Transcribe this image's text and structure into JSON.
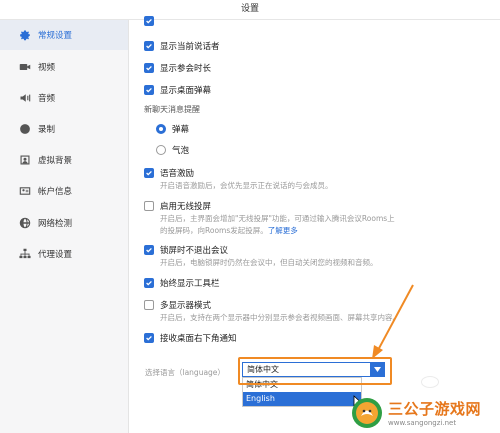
{
  "window": {
    "title": "设置"
  },
  "sidebar": {
    "items": [
      {
        "label": "常规设置",
        "icon": "gear-icon",
        "active": true
      },
      {
        "label": "视频",
        "icon": "video-camera-icon"
      },
      {
        "label": "音频",
        "icon": "speaker-icon"
      },
      {
        "label": "录制",
        "icon": "record-icon"
      },
      {
        "label": "虚拟背景",
        "icon": "person-frame-icon"
      },
      {
        "label": "帐户信息",
        "icon": "account-card-icon"
      },
      {
        "label": "网络检测",
        "icon": "globe-icon"
      },
      {
        "label": "代理设置",
        "icon": "network-icon"
      }
    ]
  },
  "settings": {
    "show_speaker": {
      "label": "显示当前说话者",
      "checked": true
    },
    "show_duration": {
      "label": "显示参会时长",
      "checked": true
    },
    "show_desktop_barrage": {
      "label": "显示桌面弹幕",
      "checked": true
    },
    "new_chat_label": "新聊天消息提醒",
    "radio_barrage": {
      "label": "弹幕",
      "selected": true
    },
    "radio_bubble": {
      "label": "气泡",
      "selected": false
    },
    "voice_excitation": {
      "label": "语音激励",
      "checked": true,
      "desc": "开启语音激励后，会优先显示正在说话的与会成员。"
    },
    "wireless_cast": {
      "label": "启用无线投屏",
      "checked": false,
      "desc1": "开启后，主界面会增加\"无线投屏\"功能，可通过输入腾讯会议Rooms上",
      "desc2": "的投屏码，向Rooms发起投屏。",
      "link": "了解更多"
    },
    "lock_screen": {
      "label": "锁屏时不退出会议",
      "checked": true,
      "desc": "开启后，电脑锁屏时仍然在会议中，但自动关闭您的视频和音频。"
    },
    "always_toolbar": {
      "label": "始终显示工具栏",
      "checked": true
    },
    "multi_display": {
      "label": "多显示器模式",
      "checked": false,
      "desc": "开启后，支持在两个显示器中分别显示参会者视频画面、屏幕共享内容。"
    },
    "desktop_notify": {
      "label": "接收桌面右下角通知",
      "checked": true
    }
  },
  "language": {
    "label": "选择语言（language）",
    "selected": "简体中文",
    "options": [
      "简体中文",
      "English"
    ],
    "hovered": "English"
  },
  "watermark": {
    "title": "三公子游戏网",
    "url": "www.sangongzi.net"
  },
  "colors": {
    "accent": "#2b6fd6",
    "annotation": "#f08a24"
  }
}
